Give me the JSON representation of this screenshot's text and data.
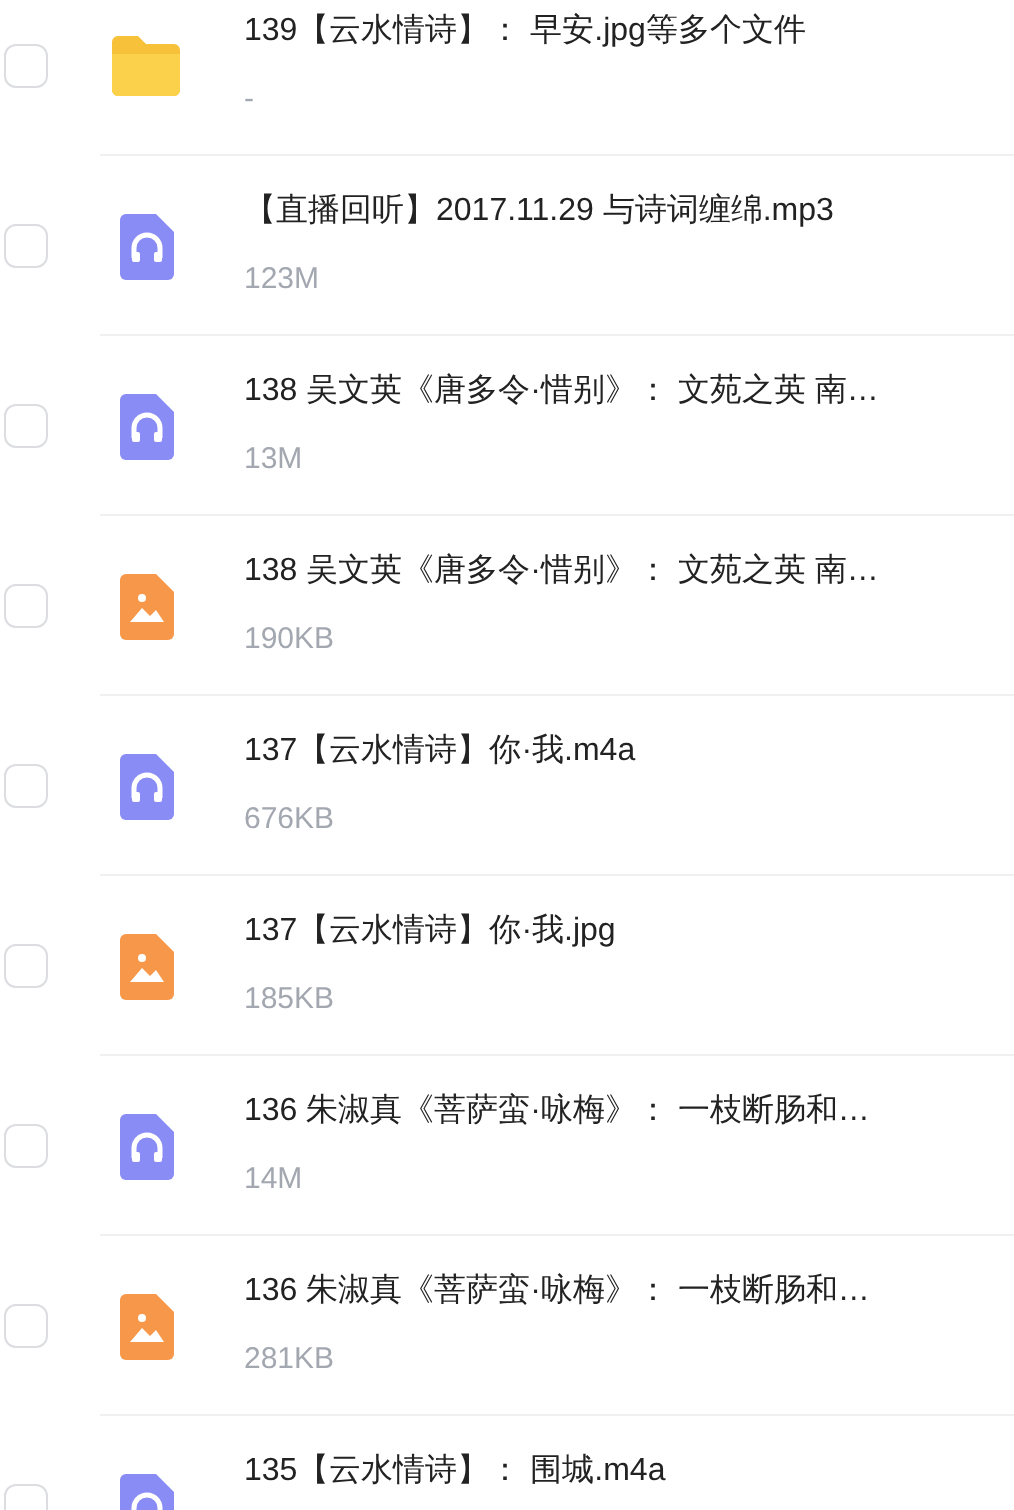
{
  "files": [
    {
      "kind": "folder",
      "name": "139【云水情诗】： 早安.jpg等多个文件",
      "size": "-",
      "checked": false
    },
    {
      "kind": "audio",
      "name": "【直播回听】2017.11.29 与诗词缠绵.mp3",
      "size": "123M",
      "checked": false
    },
    {
      "kind": "audio",
      "name": "138 吴文英《唐多令·惜别》： 文苑之英 南…",
      "size": "13M",
      "checked": false
    },
    {
      "kind": "image",
      "name": "138 吴文英《唐多令·惜别》： 文苑之英 南…",
      "size": "190KB",
      "checked": false
    },
    {
      "kind": "audio",
      "name": "137【云水情诗】你·我.m4a",
      "size": "676KB",
      "checked": false
    },
    {
      "kind": "image",
      "name": "137【云水情诗】你·我.jpg",
      "size": "185KB",
      "checked": false
    },
    {
      "kind": "audio",
      "name": "136 朱淑真《菩萨蛮·咏梅》： 一枝断肠和…",
      "size": "14M",
      "checked": false
    },
    {
      "kind": "image",
      "name": "136 朱淑真《菩萨蛮·咏梅》： 一枝断肠和…",
      "size": "281KB",
      "checked": false
    },
    {
      "kind": "audio",
      "name": "135【云水情诗】： 围城.m4a",
      "checked": false
    }
  ]
}
